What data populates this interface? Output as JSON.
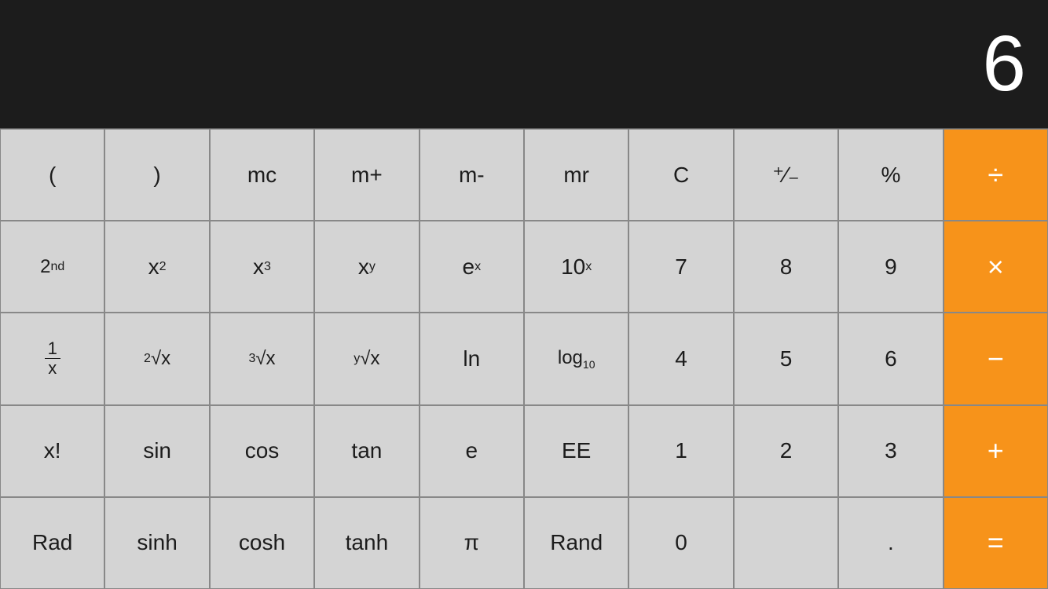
{
  "display": {
    "value": "6",
    "color": "white"
  },
  "buttons": [
    {
      "id": "open-paren",
      "label": "(",
      "type": "gray",
      "row": 1
    },
    {
      "id": "close-paren",
      "label": ")",
      "type": "gray",
      "row": 1
    },
    {
      "id": "mc",
      "label": "mc",
      "type": "gray",
      "row": 1
    },
    {
      "id": "mplus",
      "label": "m+",
      "type": "gray",
      "row": 1
    },
    {
      "id": "mminus",
      "label": "m-",
      "type": "gray",
      "row": 1
    },
    {
      "id": "mr",
      "label": "mr",
      "type": "gray",
      "row": 1
    },
    {
      "id": "clear",
      "label": "C",
      "type": "gray",
      "row": 1
    },
    {
      "id": "plusminus",
      "label": "+/−",
      "type": "gray",
      "row": 1
    },
    {
      "id": "percent",
      "label": "%",
      "type": "gray",
      "row": 1
    },
    {
      "id": "divide",
      "label": "÷",
      "type": "orange",
      "row": 1
    },
    {
      "id": "2nd",
      "label": "2nd",
      "type": "gray",
      "row": 2
    },
    {
      "id": "x2",
      "label": "x2",
      "type": "gray",
      "row": 2
    },
    {
      "id": "x3",
      "label": "x3",
      "type": "gray",
      "row": 2
    },
    {
      "id": "xy",
      "label": "xy",
      "type": "gray",
      "row": 2
    },
    {
      "id": "ex",
      "label": "ex",
      "type": "gray",
      "row": 2
    },
    {
      "id": "10x",
      "label": "10x",
      "type": "gray",
      "row": 2
    },
    {
      "id": "7",
      "label": "7",
      "type": "gray",
      "row": 2
    },
    {
      "id": "8",
      "label": "8",
      "type": "gray",
      "row": 2
    },
    {
      "id": "9",
      "label": "9",
      "type": "gray",
      "row": 2
    },
    {
      "id": "multiply",
      "label": "×",
      "type": "orange",
      "row": 2
    },
    {
      "id": "1x",
      "label": "1/x",
      "type": "gray",
      "row": 3
    },
    {
      "id": "sqrt2",
      "label": "2√x",
      "type": "gray",
      "row": 3
    },
    {
      "id": "sqrt3",
      "label": "3√x",
      "type": "gray",
      "row": 3
    },
    {
      "id": "sqrty",
      "label": "y√x",
      "type": "gray",
      "row": 3
    },
    {
      "id": "ln",
      "label": "ln",
      "type": "gray",
      "row": 3
    },
    {
      "id": "log10",
      "label": "log10",
      "type": "gray",
      "row": 3
    },
    {
      "id": "4",
      "label": "4",
      "type": "gray",
      "row": 3
    },
    {
      "id": "5",
      "label": "5",
      "type": "gray",
      "row": 3
    },
    {
      "id": "6",
      "label": "6",
      "type": "gray",
      "row": 3
    },
    {
      "id": "minus",
      "label": "−",
      "type": "orange",
      "row": 3
    },
    {
      "id": "xfact",
      "label": "x!",
      "type": "gray",
      "row": 4
    },
    {
      "id": "sin",
      "label": "sin",
      "type": "gray",
      "row": 4
    },
    {
      "id": "cos",
      "label": "cos",
      "type": "gray",
      "row": 4
    },
    {
      "id": "tan",
      "label": "tan",
      "type": "gray",
      "row": 4
    },
    {
      "id": "e",
      "label": "e",
      "type": "gray",
      "row": 4
    },
    {
      "id": "EE",
      "label": "EE",
      "type": "gray",
      "row": 4
    },
    {
      "id": "1",
      "label": "1",
      "type": "gray",
      "row": 4
    },
    {
      "id": "2",
      "label": "2",
      "type": "gray",
      "row": 4
    },
    {
      "id": "3",
      "label": "3",
      "type": "gray",
      "row": 4
    },
    {
      "id": "plus",
      "label": "+",
      "type": "orange",
      "row": 4
    },
    {
      "id": "rad",
      "label": "Rad",
      "type": "gray",
      "row": 5
    },
    {
      "id": "sinh",
      "label": "sinh",
      "type": "gray",
      "row": 5
    },
    {
      "id": "cosh",
      "label": "cosh",
      "type": "gray",
      "row": 5
    },
    {
      "id": "tanh",
      "label": "tanh",
      "type": "gray",
      "row": 5
    },
    {
      "id": "pi",
      "label": "π",
      "type": "gray",
      "row": 5
    },
    {
      "id": "rand",
      "label": "Rand",
      "type": "gray",
      "row": 5
    },
    {
      "id": "0",
      "label": "0",
      "type": "gray",
      "row": 5
    },
    {
      "id": "empty1",
      "label": "",
      "type": "gray",
      "row": 5
    },
    {
      "id": "dot",
      "label": ".",
      "type": "gray",
      "row": 5
    },
    {
      "id": "equals",
      "label": "=",
      "type": "orange",
      "row": 5
    }
  ],
  "colors": {
    "orange": "#f7931a",
    "gray_btn": "#d4d4d4",
    "dark_gray_btn": "#c8c8c8",
    "display_bg": "#1c1c1c",
    "border": "#888888"
  }
}
